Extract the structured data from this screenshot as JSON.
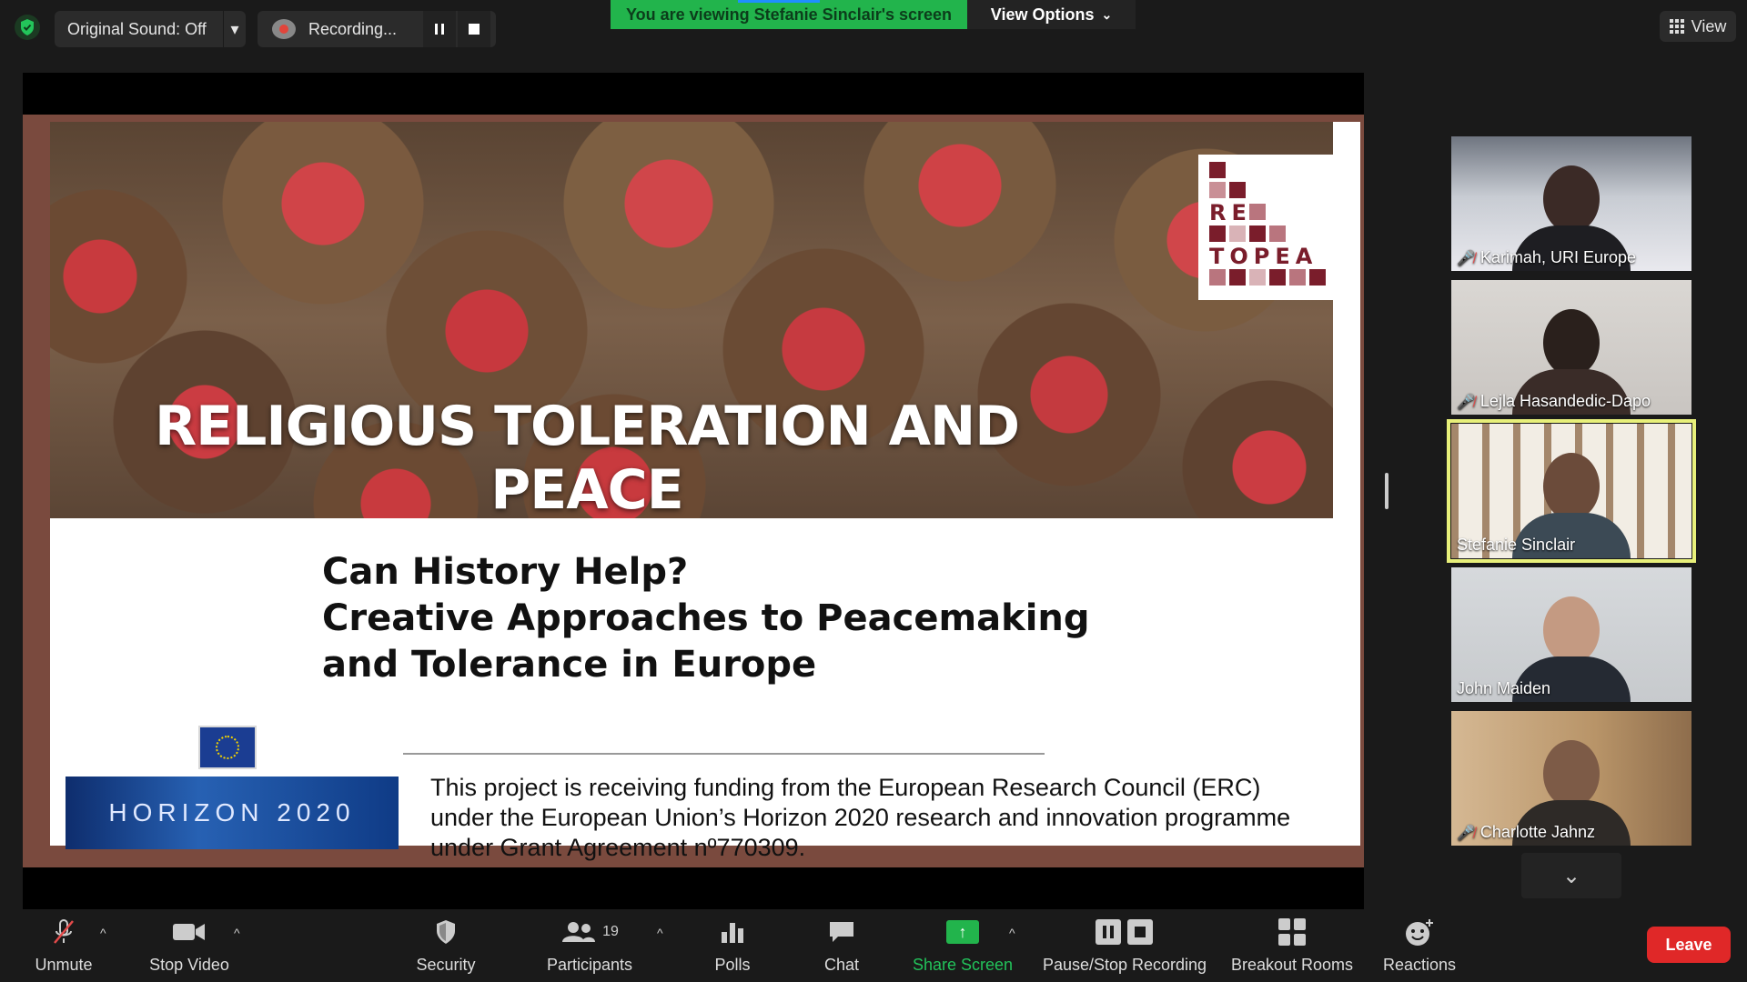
{
  "topbar": {
    "original_sound": "Original Sound: Off",
    "recording_label": "Recording...",
    "viewing_banner": "You are viewing Stefanie Sinclair's screen",
    "view_options": "View Options",
    "view_button": "View"
  },
  "slide": {
    "title": "RELIGIOUS TOLERATION AND PEACE",
    "logo_line1": "RE",
    "logo_line2": "TOPEA",
    "subtitle_line1": "Can History Help?",
    "subtitle_line2": "Creative Approaches to Peacemaking",
    "subtitle_line3": "and Tolerance in Europe",
    "horizon_label": "HORIZON 2020",
    "funding_line1": "This project is receiving funding from the European Research Council (ERC)",
    "funding_line2": "under the European Union’s Horizon 2020 research and innovation programme",
    "funding_line3": "under Grant Agreement nº770309."
  },
  "participants_panel": [
    {
      "name": "Karimah, URI Europe",
      "muted": true,
      "active": false
    },
    {
      "name": "Lejla Hasandedic-Dapo",
      "muted": true,
      "active": false
    },
    {
      "name": "Stefanie Sinclair",
      "muted": false,
      "active": true
    },
    {
      "name": "John Maiden",
      "muted": false,
      "active": false
    },
    {
      "name": "Charlotte Jahnz",
      "muted": true,
      "active": false
    }
  ],
  "toolbar": {
    "unmute": "Unmute",
    "stop_video": "Stop Video",
    "security": "Security",
    "participants": "Participants",
    "participants_count": "19",
    "polls": "Polls",
    "chat": "Chat",
    "share_screen": "Share Screen",
    "pause_stop_recording": "Pause/Stop Recording",
    "breakout_rooms": "Breakout Rooms",
    "reactions": "Reactions",
    "leave": "Leave"
  },
  "colors": {
    "share_green": "#22b44c",
    "leave_red": "#e02828",
    "active_outline": "#e8f07a"
  }
}
